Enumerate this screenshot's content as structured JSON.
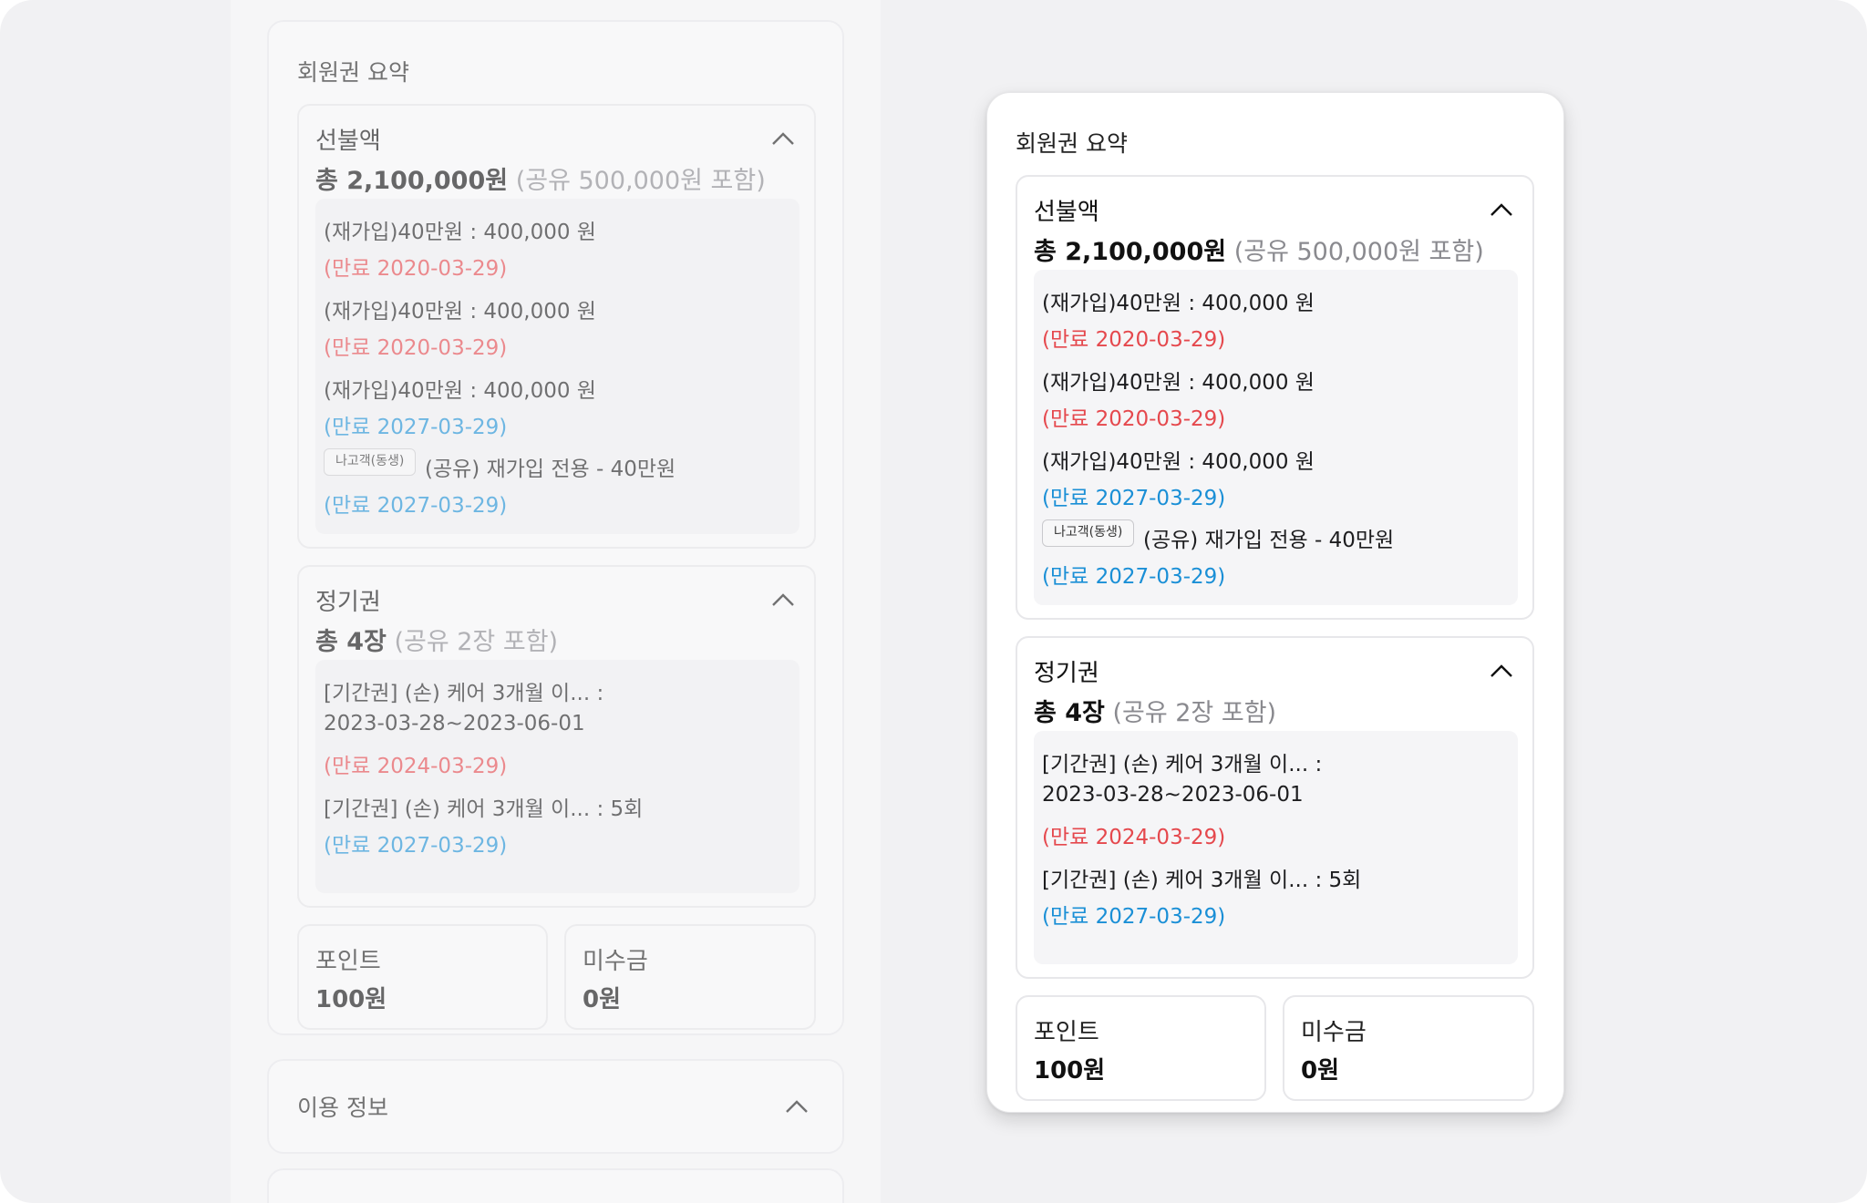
{
  "summary": {
    "title": "회원권 요약"
  },
  "prepaid": {
    "label": "선불액",
    "total_main": "총 2,100,000원",
    "total_sub": " (공유 500,000원 포함)",
    "items": [
      {
        "text": "(재가입)40만원 : 400,000 원",
        "expiry": "(만료 2020-03-29)",
        "status": "expired"
      },
      {
        "text": "(재가입)40만원 : 400,000 원",
        "expiry": "(만료 2020-03-29)",
        "status": "expired"
      },
      {
        "text": "(재가입)40만원 : 400,000 원",
        "expiry": "(만료 2027-03-29)",
        "status": "active"
      },
      {
        "tag": "나고객(동생)",
        "text": "(공유) 재가입 전용 - 40만원",
        "expiry": "(만료 2027-03-29)",
        "status": "active"
      }
    ]
  },
  "pass": {
    "label": "정기권",
    "total_main": "총 4장",
    "total_sub": " (공유 2장 포함)",
    "items": [
      {
        "text": "[기간권] (손) 케어 3개월 이... :",
        "text2": "2023-03-28~2023-06-01",
        "expiry": "(만료 2024-03-29)",
        "status": "expired"
      },
      {
        "text": "[기간권] (손) 케어 3개월 이... : 5회",
        "expiry": "(만료 2027-03-29)",
        "status": "active"
      }
    ]
  },
  "points": {
    "label": "포인트",
    "value": "100원"
  },
  "unpaid": {
    "label": "미수금",
    "value": "0원"
  },
  "usage": {
    "title": "이용 정보"
  },
  "colors": {
    "expired": "#e5484d",
    "active": "#1a8fd6",
    "background": "#f1f1f3"
  },
  "icons": {
    "collapse": "chevron-up-icon"
  }
}
